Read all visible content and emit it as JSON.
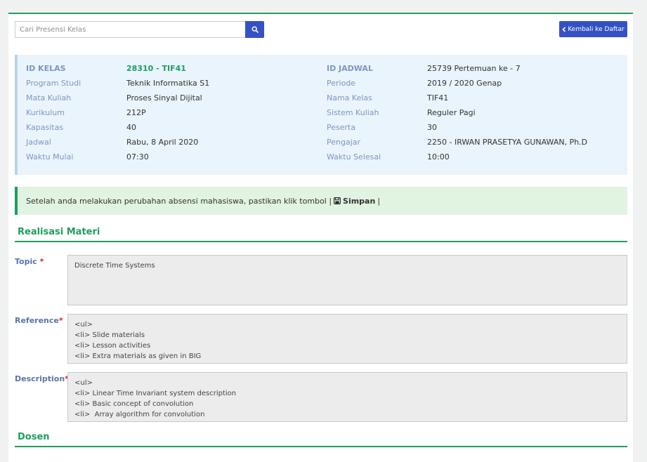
{
  "search": {
    "placeholder": "Cari Presensi Kelas"
  },
  "back_button": {
    "label": "Kembali ke Daftar"
  },
  "info": {
    "left": [
      {
        "label": "ID KELAS",
        "value": "28310 - TIF41"
      },
      {
        "label": "Program Studi",
        "value": "Teknik Informatika S1"
      },
      {
        "label": "Mata Kuliah",
        "value": "Proses Sinyal Dijital"
      },
      {
        "label": "Kurikulum",
        "value": "212P"
      },
      {
        "label": "Kapasitas",
        "value": "40"
      },
      {
        "label": "Jadwal",
        "value": "Rabu, 8 April 2020"
      },
      {
        "label": "Waktu Mulai",
        "value": "07:30"
      }
    ],
    "right": [
      {
        "label": "ID JADWAL",
        "value": "25739 Pertemuan ke - 7"
      },
      {
        "label": "Periode",
        "value": "2019 / 2020 Genap"
      },
      {
        "label": "Nama Kelas",
        "value": "TIF41"
      },
      {
        "label": "Sistem Kuliah",
        "value": "Reguler Pagi"
      },
      {
        "label": "Peserta",
        "value": "30"
      },
      {
        "label": "Pengajar",
        "value": "2250 - IRWAN PRASETYA GUNAWAN, Ph.D"
      },
      {
        "label": "Waktu Selesai",
        "value": "10:00"
      }
    ]
  },
  "alert": {
    "text": "Setelah anda melakukan perubahan absensi mahasiswa, pastikan klik tombol |",
    "button_label": "Simpan",
    "suffix": "|"
  },
  "realisasi": {
    "title": "Realisasi Materi",
    "topic_label": "Topic",
    "topic_value": "Discrete Time Systems",
    "reference_label": "Reference",
    "reference_value": "<ul>\n<li> Slide materials\n<li> Lesson activities\n<li> Extra materials as given in BIG\n</ul>",
    "description_label": "Description",
    "description_value": "<ul>\n<li> Linear Time Invariant system description\n<li> Basic concept of convolution\n<li>  Array algorithm for convolution\n<li> Look-up"
  },
  "dosen": {
    "title": "Dosen"
  },
  "colors": {
    "accent": "#1e9e5e",
    "primary_button": "#3552c4",
    "info_bg": "#eaf4fc",
    "alert_bg": "#e1f3e1"
  },
  "icons": {
    "search": "search-icon",
    "back": "chevron-left-icon",
    "save": "floppy-disk-icon"
  }
}
